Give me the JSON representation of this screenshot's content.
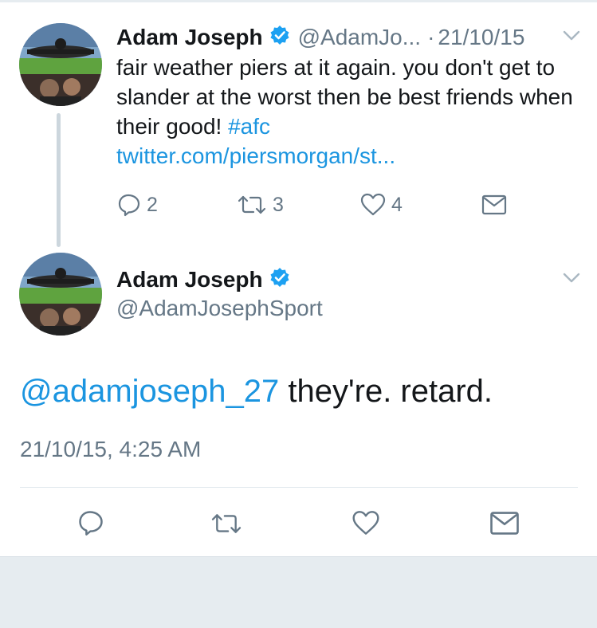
{
  "parent_tweet": {
    "author_name": "Adam Joseph",
    "handle": "@AdamJo...",
    "dot": "·",
    "time": "21/10/15",
    "text": "fair weather piers at it again. you don't get to slander at the worst then be best friends when their good! ",
    "hashtag": "#afc",
    "link": "twitter.com/piersmorgan/st...",
    "actions": {
      "reply_count": "2",
      "retweet_count": "3",
      "like_count": "4"
    }
  },
  "main_tweet": {
    "author_name": "Adam Joseph",
    "handle": "@AdamJosephSport",
    "mention": "@adamjoseph_27",
    "text": " they're. retard.",
    "timestamp": "21/10/15, 4:25 AM"
  },
  "icons": {
    "verified": "verified-badge-icon",
    "chevron": "chevron-down-icon",
    "reply": "reply-icon",
    "retweet": "retweet-icon",
    "like": "heart-icon",
    "dm": "envelope-icon"
  },
  "colors": {
    "text": "#14171a",
    "secondary": "#657786",
    "link": "#1b95e0",
    "verified": "#1da1f2",
    "thread_line": "#ccd6dd",
    "footer_background": "#e6ecf0"
  }
}
